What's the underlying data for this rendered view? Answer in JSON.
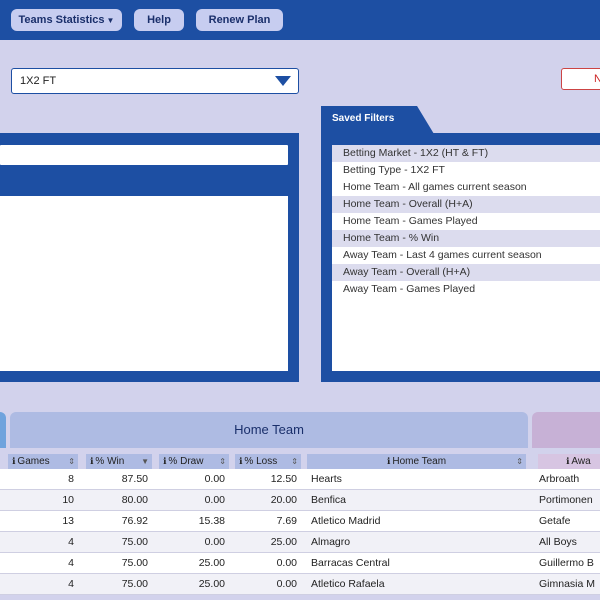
{
  "nav": {
    "teams_statistics": "Teams Statistics",
    "help": "Help",
    "renew_plan": "Renew Plan"
  },
  "filter": {
    "selected": "1X2 FT",
    "n_button": "N"
  },
  "saved_filters": {
    "title": "Saved Filters",
    "items": [
      "Betting Market - 1X2 (HT & FT)",
      "Betting Type - 1X2 FT",
      "Home Team - All games current season",
      "Home Team - Overall (H+A)",
      "Home Team - Games Played",
      "Home Team - % Win",
      "Away Team - Last 4 games current season",
      "Away Team - Overall (H+A)",
      "Away Team - Games Played"
    ]
  },
  "table": {
    "section_home": "Home Team",
    "headers": {
      "games": "Games",
      "win": "% Win",
      "draw": "% Draw",
      "loss": "% Loss",
      "home_team": "Home Team",
      "away_team": "Awa"
    },
    "rows": [
      {
        "games": "8",
        "win": "87.50",
        "draw": "0.00",
        "loss": "12.50",
        "home": "Hearts",
        "away": "Arbroath"
      },
      {
        "games": "10",
        "win": "80.00",
        "draw": "0.00",
        "loss": "20.00",
        "home": "Benfica",
        "away": "Portimonen"
      },
      {
        "games": "13",
        "win": "76.92",
        "draw": "15.38",
        "loss": "7.69",
        "home": "Atletico Madrid",
        "away": "Getafe"
      },
      {
        "games": "4",
        "win": "75.00",
        "draw": "0.00",
        "loss": "25.00",
        "home": "Almagro",
        "away": "All Boys"
      },
      {
        "games": "4",
        "win": "75.00",
        "draw": "25.00",
        "loss": "0.00",
        "home": "Barracas Central",
        "away": "Guillermo B"
      },
      {
        "games": "4",
        "win": "75.00",
        "draw": "25.00",
        "loss": "0.00",
        "home": "Atletico Rafaela",
        "away": "Gimnasia M"
      }
    ]
  }
}
